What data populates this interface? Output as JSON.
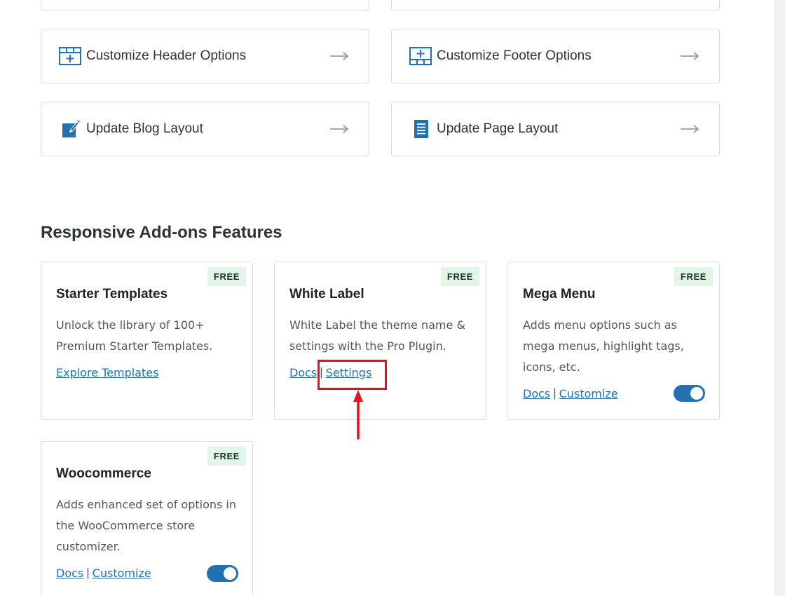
{
  "quick_links": [
    {
      "label": "Customize Header Options",
      "icon": "header-grid-icon"
    },
    {
      "label": "Customize Footer Options",
      "icon": "footer-grid-icon"
    },
    {
      "label": "Update Blog Layout",
      "icon": "edit-post-icon"
    },
    {
      "label": "Update Page Layout",
      "icon": "page-document-icon"
    }
  ],
  "section": {
    "title": "Responsive Add-ons Features"
  },
  "addons": [
    {
      "badge": "FREE",
      "title": "Starter Templates",
      "description": "Unlock the library of 100+ Premium Starter Templates.",
      "link1": "Explore Templates"
    },
    {
      "badge": "FREE",
      "title": "White Label",
      "description": "White Label the theme name & settings with the Pro Plugin.",
      "link1": "Docs",
      "separator": "|",
      "link2": "Settings"
    },
    {
      "badge": "FREE",
      "title": "Mega Menu",
      "description": "Adds menu options such as mega menus, highlight tags, icons, etc.",
      "link1": "Docs",
      "separator": "|",
      "link2": "Customize",
      "toggle_on": true
    },
    {
      "badge": "FREE",
      "title": "Woocommerce",
      "description": "Adds enhanced set of options in the WooCommerce store customizer.",
      "link1": "Docs",
      "separator": "|",
      "link2": "Customize",
      "toggle_on": true
    }
  ],
  "colors": {
    "accent": "#2271b1",
    "badge_bg": "#e1f6e6",
    "annotation": "#e3111a"
  }
}
